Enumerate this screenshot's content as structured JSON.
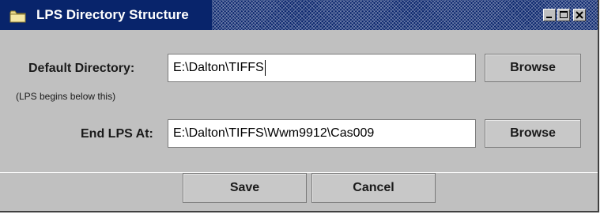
{
  "window": {
    "title": "LPS Directory Structure",
    "title_icon": "folder-icon",
    "controls": [
      "minimize-icon",
      "maximize-icon",
      "close-icon"
    ],
    "title_bar_color": "#08246b",
    "background_color": "#c0c0c0"
  },
  "form": {
    "default_directory": {
      "label": "Default Directory:",
      "value": "E:\\Dalton\\TIFFS",
      "hint": "(LPS begins below this)",
      "browse_label": "Browse"
    },
    "end_lps": {
      "label": "End LPS At:",
      "value": "E:\\Dalton\\TIFFS\\Wwm9912\\Cas009",
      "browse_label": "Browse"
    }
  },
  "footer": {
    "save_label": "Save",
    "cancel_label": "Cancel"
  }
}
